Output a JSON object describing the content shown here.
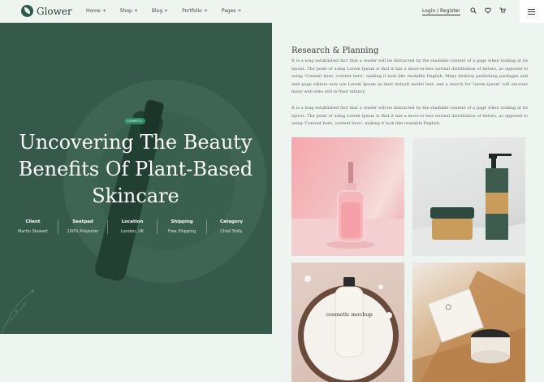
{
  "header": {
    "logo": "Glower",
    "nav": [
      {
        "label": "Home"
      },
      {
        "label": "Shop"
      },
      {
        "label": "Blog"
      },
      {
        "label": "Portfolio"
      },
      {
        "label": "Pages"
      }
    ],
    "nav_plus": "+",
    "login": "Login / Register",
    "icons": [
      "search-icon",
      "heart-icon",
      "cart-icon",
      "menu-icon"
    ]
  },
  "hero": {
    "badge": "COSMETIC",
    "title": "Uncovering The Beauty Benefits Of Plant-Based Skincare",
    "meta": [
      {
        "label": "Client",
        "value": "Martin Stewart"
      },
      {
        "label": "Seatpad",
        "value": "100% Polyester"
      },
      {
        "label": "Location",
        "value": "London, UK"
      },
      {
        "label": "Shipping",
        "value": "Free Shipping"
      },
      {
        "label": "Category",
        "value": "Child Trolly"
      }
    ],
    "colors": {
      "background": "#35594a",
      "badge": "#2e8a63"
    }
  },
  "content": {
    "title": "Research & Planning",
    "paragraph1": "It is a long established fact that a reader will be distracted by the readable content of a page when looking at its layout. The point of using Lorem Ipsum is that it has a more-or-less normal distribution of letters, as opposed to using 'Content here, content here', making it look like readable English. Many desktop publishing packages and web page editors now use Lorem Ipsum as their default model text, and a search for 'lorem ipsum' will uncover many web sites still in their infancy.",
    "paragraph2": "It is a long established fact that a reader will be distracted by the readable content of a page when looking at its layout. The point of using Lorem Ipsum is that it has a more-or-less normal distribution of letters, as opposed to using 'Content here, content here', making it look like readable English.",
    "mockup_label": "cosmetic mockup"
  }
}
